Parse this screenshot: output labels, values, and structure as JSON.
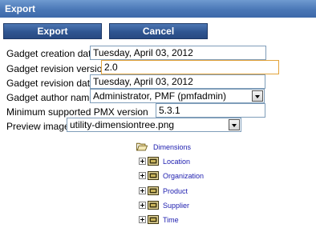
{
  "window": {
    "title": "Export"
  },
  "toolbar": {
    "export_label": "Export",
    "cancel_label": "Cancel"
  },
  "form": {
    "creation_date_label": "Gadget creation date",
    "creation_date_value": "Tuesday, April 03, 2012",
    "revision_version_label": "Gadget revision version",
    "revision_version_value": "2.0",
    "revision_date_label": "Gadget revision date",
    "revision_date_value": "Tuesday, April 03, 2012",
    "author_label": "Gadget author name",
    "author_value": "Administrator, PMF (pmfadmin)",
    "pmx_version_label": "Minimum supported PMX version",
    "pmx_version_value": "5.3.1",
    "preview_label": "Preview image",
    "preview_value": "utility-dimensiontree.png"
  },
  "tree": {
    "root": {
      "label": "Dimensions",
      "icon": "open-folder-icon"
    },
    "children": [
      {
        "label": "Location",
        "icon": "dimension-icon"
      },
      {
        "label": "Organization",
        "icon": "dimension-icon"
      },
      {
        "label": "Product",
        "icon": "dimension-icon"
      },
      {
        "label": "Supplier",
        "icon": "dimension-icon"
      },
      {
        "label": "Time",
        "icon": "dimension-icon"
      }
    ]
  },
  "colors": {
    "titlebar": "#4a77b6",
    "button": "#2f5591",
    "focus_border": "#e3a33a",
    "tree_text": "#2020b0"
  }
}
